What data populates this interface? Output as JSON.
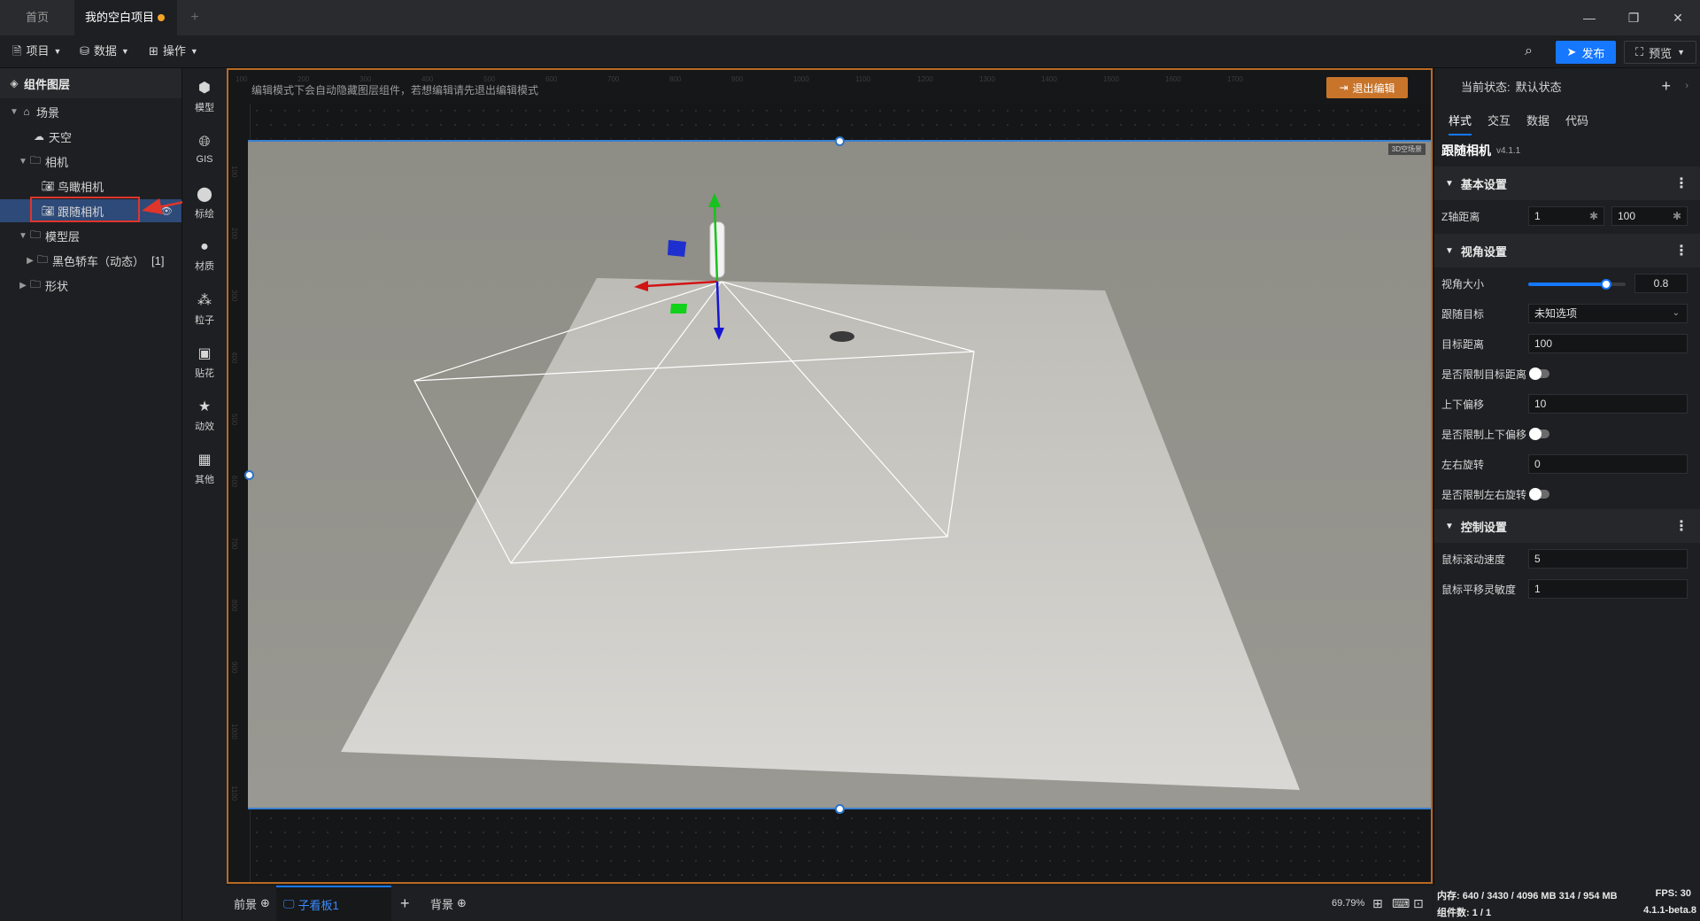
{
  "tabs": {
    "home": "首页",
    "project": "我的空白项目",
    "add": "+"
  },
  "window": {
    "minimize": "—",
    "restore": "❐",
    "close": "✕"
  },
  "menus": {
    "project": "项目",
    "data": "数据",
    "operate": "操作"
  },
  "toolbar": {
    "publish": "发布",
    "preview": "预览",
    "accent": "#1677ff"
  },
  "layers": {
    "title": "组件图层",
    "items": [
      {
        "label": "场景",
        "icon": "scene-icon"
      },
      {
        "label": "天空",
        "icon": "sky-icon"
      },
      {
        "label": "相机",
        "icon": "folder-icon"
      },
      {
        "label": "鸟瞰相机",
        "icon": "camera-icon"
      },
      {
        "label": "跟随相机",
        "icon": "camera-icon"
      },
      {
        "label": "模型层",
        "icon": "folder-icon"
      },
      {
        "label": "黑色轿车（动态）",
        "icon": "folder-icon",
        "badge": "[1]"
      },
      {
        "label": "形状",
        "icon": "folder-icon"
      }
    ]
  },
  "components": [
    {
      "label": "模型",
      "icon": "cube-icon"
    },
    {
      "label": "GIS",
      "icon": "globe-icon"
    },
    {
      "label": "标绘",
      "icon": "pin-icon"
    },
    {
      "label": "材质",
      "icon": "sphere-icon"
    },
    {
      "label": "粒子",
      "icon": "particle-icon"
    },
    {
      "label": "贴花",
      "icon": "decal-icon"
    },
    {
      "label": "动效",
      "icon": "star-icon"
    },
    {
      "label": "其他",
      "icon": "grid-icon"
    }
  ],
  "canvas": {
    "hint": "编辑模式下会自动隐藏图层组件，若想编辑请先退出编辑模式",
    "exit_edit": "退出编辑",
    "scene_badge": "3D空场景",
    "ruler_top": [
      "100",
      "200",
      "300",
      "400",
      "500",
      "600",
      "700",
      "800",
      "900",
      "1000",
      "1100",
      "1200",
      "1300",
      "1400",
      "1500",
      "1600",
      "1700"
    ],
    "ruler_left": [
      "100",
      "200",
      "300",
      "400",
      "500",
      "600",
      "700",
      "800",
      "900",
      "1000",
      "1100"
    ]
  },
  "bottom": {
    "front": "前景",
    "board": "子看板1",
    "add": "+",
    "back": "背景",
    "zoom": "69.79%"
  },
  "right": {
    "state_label": "当前状态:",
    "state_value": "默认状态",
    "tabs": [
      "样式",
      "交互",
      "数据",
      "代码"
    ],
    "component_name": "跟随相机",
    "component_version": "v4.1.1",
    "sections": {
      "basic": "基本设置",
      "view": "视角设置",
      "control": "控制设置"
    },
    "z_label": "Z轴距离",
    "z_min": "1",
    "z_max": "100",
    "fov_label": "视角大小",
    "fov_value": "0.8",
    "fov_fraction": 0.8,
    "target_label": "跟随目标",
    "target_value": "未知选项",
    "distance_label": "目标距离",
    "distance_value": "100",
    "limit_distance_label": "是否限制目标距离",
    "offset_label": "上下偏移",
    "offset_value": "10",
    "limit_offset_label": "是否限制上下偏移",
    "rotate_label": "左右旋转",
    "rotate_value": "0",
    "limit_rotate_label": "是否限制左右旋转",
    "scroll_label": "鼠标滚动速度",
    "scroll_value": "5",
    "pan_label": "鼠标平移灵敏度",
    "pan_value": "1"
  },
  "status": {
    "memory": "内存:  640 / 3430 / 4096 MB  314 / 954 MB",
    "fps": "FPS:  30",
    "components": "组件数: 1 / 1",
    "version": "4.1.1-beta.8"
  }
}
